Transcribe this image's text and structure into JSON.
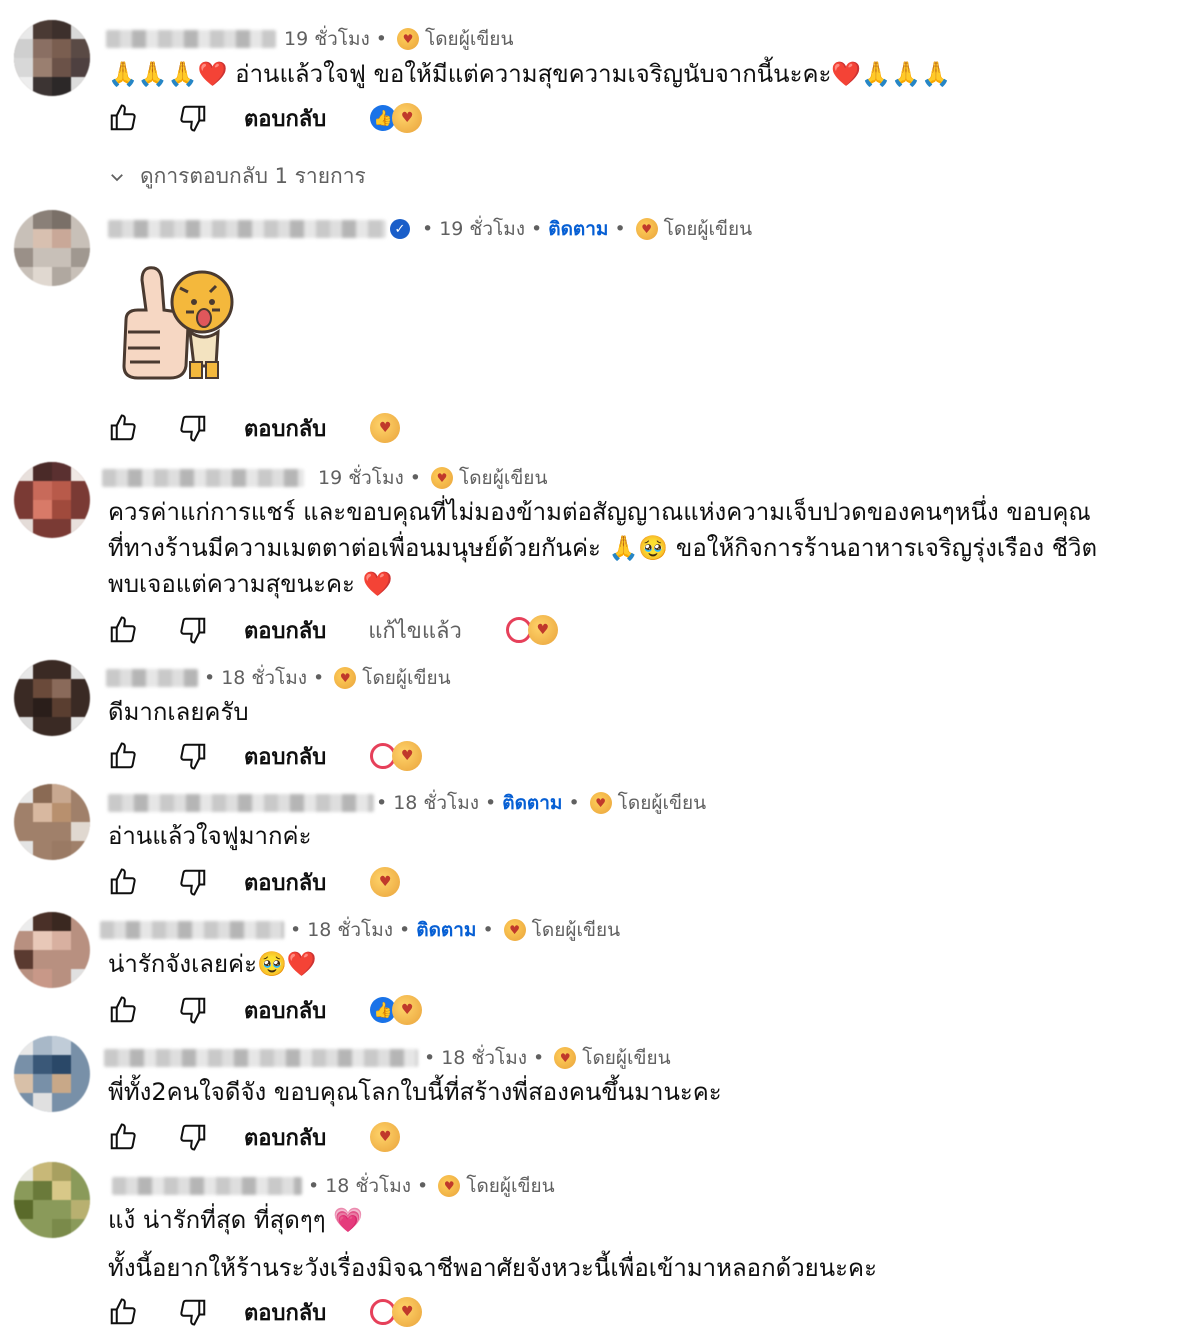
{
  "comments": [
    {
      "time": "19 ชั่วโมง",
      "by_creator": "โดยผู้เขียน",
      "text_lines": [
        "🙏🙏🙏❤️ อ่านแล้วใจฟู ขอให้มีแต่ความสุขความเจริญนับจากนี้นะคะ❤️🙏🙏🙏"
      ],
      "reply_label": "ตอบกลับ",
      "reaction": "like"
    },
    {
      "time": "19 ชั่วโมง",
      "follow": "ติดตาม",
      "by_creator": "โดยผู้เขียน",
      "reply_label": "ตอบกลับ",
      "reaction": "none",
      "verified": true
    },
    {
      "time": "19 ชั่วโมง",
      "by_creator": "โดยผู้เขียน",
      "text_lines": [
        "ควรค่าแก่การแชร์ และขอบคุณที่ไม่มองข้ามต่อสัญญาณแห่งความเจ็บปวดของคนๆหนึ่ง ขอบคุณ",
        "ที่ทางร้านมีความเมตตาต่อเพื่อนมนุษย์ด้วยกันค่ะ 🙏🥹 ขอให้กิจการร้านอาหารเจริญรุ่งเรือง ชีวิต",
        "พบเจอแต่ความสุขนะคะ ❤️"
      ],
      "reply_label": "ตอบกลับ",
      "edited_label": "แก้ไขแล้ว",
      "reaction": "heart"
    },
    {
      "time": "18 ชั่วโมง",
      "by_creator": "โดยผู้เขียน",
      "text_lines": [
        "ดีมากเลยครับ"
      ],
      "reply_label": "ตอบกลับ",
      "reaction": "heart"
    },
    {
      "time": "18 ชั่วโมง",
      "follow": "ติดตาม",
      "by_creator": "โดยผู้เขียน",
      "text_lines": [
        "อ่านแล้วใจฟูมากค่ะ"
      ],
      "reply_label": "ตอบกลับ",
      "reaction": "none"
    },
    {
      "time": "18 ชั่วโมง",
      "follow": "ติดตาม",
      "by_creator": "โดยผู้เขียน",
      "text_lines": [
        "น่ารักจังเลยค่ะ🥹❤️"
      ],
      "reply_label": "ตอบกลับ",
      "reaction": "like"
    },
    {
      "time": "18 ชั่วโมง",
      "by_creator": "โดยผู้เขียน",
      "text_lines": [
        "พี่ทั้ง2คนใจดีจัง ขอบคุณโลกใบนี้ที่สร้างพี่สองคนขึ้นมานะคะ"
      ],
      "reply_label": "ตอบกลับ",
      "reaction": "none"
    },
    {
      "time": "18 ชั่วโมง",
      "by_creator": "โดยผู้เขียน",
      "text_lines": [
        "แง้ น่ารักที่สุด ที่สุดๆๆ 💗",
        "ทั้งนี้อยากให้ร้านระวังเรื่องมิจฉาชีพอาศัยจังหวะนี้เพื่อเข้ามาหลอกด้วยนะคะ"
      ],
      "reply_label": "ตอบกลับ",
      "reaction": "heart"
    }
  ],
  "view_replies_label": "ดูการตอบกลับ 1 รายการ",
  "colors": {
    "link_blue": "#065fd4",
    "meta_gray": "#606060",
    "like_blue": "#1a73e8",
    "heart_red": "#e6405a"
  }
}
